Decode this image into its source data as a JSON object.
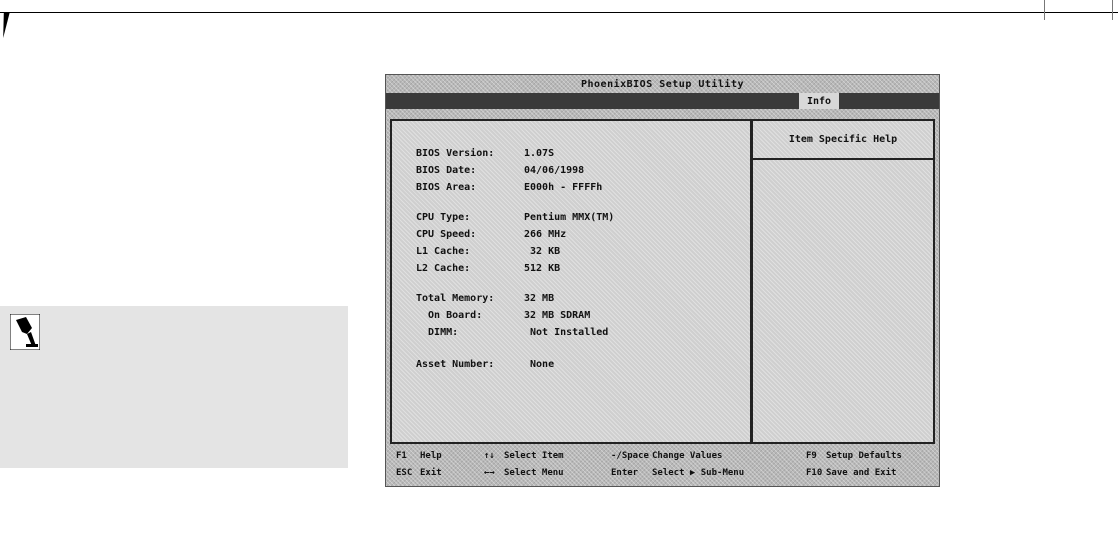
{
  "bios": {
    "title": "PhoenixBIOS Setup Utility",
    "menu": {
      "active_tab": "Info"
    },
    "help_header": "Item Specific Help",
    "rows": [
      {
        "label": "BIOS Version:",
        "value": "1.07S"
      },
      {
        "label": "BIOS Date:",
        "value": "04/06/1998"
      },
      {
        "label": "BIOS Area:",
        "value": "E000h - FFFFh"
      },
      {
        "label": "CPU Type:",
        "value": "Pentium MMX(TM)"
      },
      {
        "label": "CPU Speed:",
        "value": "266 MHz"
      },
      {
        "label": "L1 Cache:",
        "value": " 32 KB"
      },
      {
        "label": "L2 Cache:",
        "value": "512 KB"
      },
      {
        "label": "Total Memory:",
        "value": "32 MB"
      },
      {
        "label": "  On Board:",
        "value": "32 MB SDRAM"
      },
      {
        "label": "  DIMM:",
        "value": " Not Installed"
      },
      {
        "label": "Asset Number:",
        "value": " None"
      }
    ],
    "footer": {
      "f1_key": "F1",
      "f1_text": "Help",
      "esc_key": "ESC",
      "esc_text": "Exit",
      "updown_key": "↑↓",
      "updown_text": "Select Item",
      "leftright_key": "←→",
      "leftright_text": "Select Menu",
      "change_key": "-/Space",
      "change_text": "Change Values",
      "enter_key": "Enter",
      "enter_text": "Select ▶ Sub-Menu",
      "f9_key": "F9",
      "f9_text": "Setup Defaults",
      "f10_key": "F10",
      "f10_text": "Save and Exit"
    }
  },
  "icons": {
    "note": "pen-note-icon"
  }
}
